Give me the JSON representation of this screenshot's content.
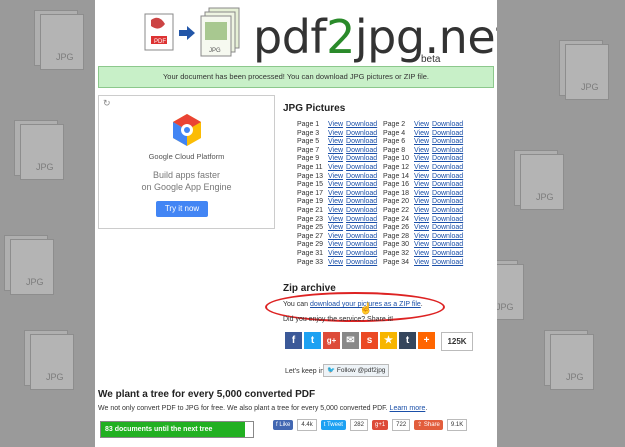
{
  "logo": {
    "part1": "pdf",
    "part2": "2",
    "part3": "jpg.net",
    "badge": "beta",
    "pdf_label": "PDF",
    "jpg_label": "JPG"
  },
  "notice": "Your document has been processed! You can download JPG pictures or ZIP file.",
  "ad": {
    "brand": "Google Cloud Platform",
    "line1": "Build apps faster",
    "line2": "on Google App Engine",
    "cta": "Try it now"
  },
  "jpg_section": {
    "title": "JPG Pictures",
    "view_label": "View",
    "download_label": "Download",
    "rows": [
      [
        "Page 1",
        "Page 2"
      ],
      [
        "Page 3",
        "Page 4"
      ],
      [
        "Page 5",
        "Page 6"
      ],
      [
        "Page 7",
        "Page 8"
      ],
      [
        "Page 9",
        "Page 10"
      ],
      [
        "Page 11",
        "Page 12"
      ],
      [
        "Page 13",
        "Page 14"
      ],
      [
        "Page 15",
        "Page 16"
      ],
      [
        "Page 17",
        "Page 18"
      ],
      [
        "Page 19",
        "Page 20"
      ],
      [
        "Page 21",
        "Page 22"
      ],
      [
        "Page 23",
        "Page 24"
      ],
      [
        "Page 25",
        "Page 26"
      ],
      [
        "Page 27",
        "Page 28"
      ],
      [
        "Page 29",
        "Page 30"
      ],
      [
        "Page 31",
        "Page 32"
      ],
      [
        "Page 33",
        "Page 34"
      ]
    ]
  },
  "zip_section": {
    "title": "Zip archive",
    "prefix": "You can ",
    "link": "download your pictures as a ZIP file",
    "suffix": "."
  },
  "enjoy_text": "Did you enjoy the service? Share it!",
  "share_count": "125K",
  "keep_in_touch": "Let's keep in touch!",
  "follow_label": "Follow @pdf2jpg",
  "tree": {
    "title": "We plant a tree for every 5,000 converted PDF",
    "text": "We not only convert PDF to JPG for free. We also plant a tree for every 5,000 converted PDF. ",
    "learn_more": "Learn more",
    "progress_label": "83 documents until the next tree",
    "progress_fraction": 0.95
  },
  "social_counts": {
    "like_label": "Like",
    "like_count": "4.4k",
    "tweet_label": "Tweet",
    "tweet_count": "282",
    "gplus_label": "+1",
    "gplus_count": "722",
    "share_label": "Share",
    "share_count": "9.1K"
  },
  "colors": {
    "accent": "#2a8a2a",
    "link": "#1a4fa8",
    "notice_bg": "#c8f0c8",
    "highlight": "#dd2222"
  }
}
